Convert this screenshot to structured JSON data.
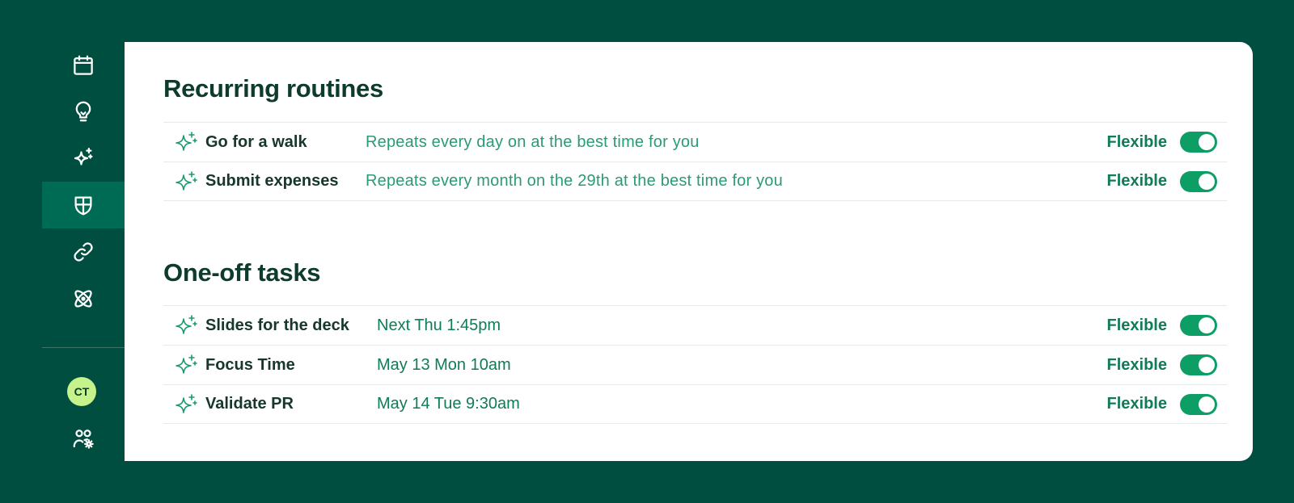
{
  "sidebar": {
    "avatar_initials": "CT",
    "items": [
      {
        "name": "calendar-icon"
      },
      {
        "name": "lightbulb-icon"
      },
      {
        "name": "sparkles-icon"
      },
      {
        "name": "shield-icon",
        "active": true
      },
      {
        "name": "link-icon"
      },
      {
        "name": "atom-icon"
      }
    ]
  },
  "recurring": {
    "title": "Recurring routines",
    "rows": [
      {
        "name": "Go for a walk",
        "desc": "Repeats every day on at the best time for you",
        "status": "Flexible",
        "enabled": true
      },
      {
        "name": "Submit expenses",
        "desc": "Repeats every month on the 29th at the best time for you",
        "status": "Flexible",
        "enabled": true
      }
    ]
  },
  "oneoff": {
    "title": "One-off tasks",
    "rows": [
      {
        "name": "Slides for the deck",
        "desc": "Next Thu 1:45pm",
        "status": "Flexible",
        "enabled": true
      },
      {
        "name": "Focus Time",
        "desc": "May 13 Mon 10am",
        "status": "Flexible",
        "enabled": true
      },
      {
        "name": "Validate PR",
        "desc": "May 14 Tue 9:30am",
        "status": "Flexible",
        "enabled": true
      }
    ]
  },
  "colors": {
    "background": "#004e3f",
    "active_nav": "#006b55",
    "accent": "#0d9e66",
    "avatar": "#c5f28a"
  }
}
